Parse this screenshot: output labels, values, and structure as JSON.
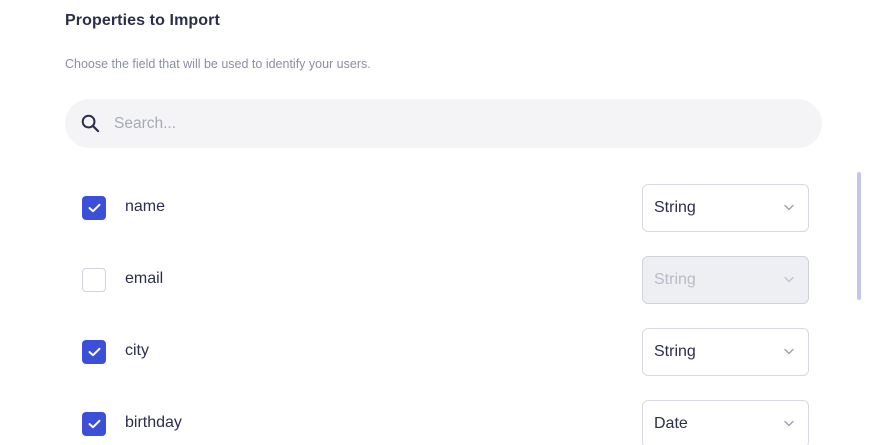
{
  "header": {
    "title": "Properties to Import",
    "subtitle": "Choose the field that will be used to identify your users."
  },
  "search": {
    "placeholder": "Search...",
    "value": ""
  },
  "icons": {
    "search": "search-icon",
    "check": "check-icon",
    "chevron": "chevron-down-icon"
  },
  "colors": {
    "accent": "#3b4fd8",
    "text": "#2b2f4a",
    "muted": "#8b8fa3"
  },
  "properties": [
    {
      "name": "name",
      "checked": true,
      "type": "String",
      "disabled": false
    },
    {
      "name": "email",
      "checked": false,
      "type": "String",
      "disabled": true
    },
    {
      "name": "city",
      "checked": true,
      "type": "String",
      "disabled": false
    },
    {
      "name": "birthday",
      "checked": true,
      "type": "Date",
      "disabled": false
    }
  ]
}
